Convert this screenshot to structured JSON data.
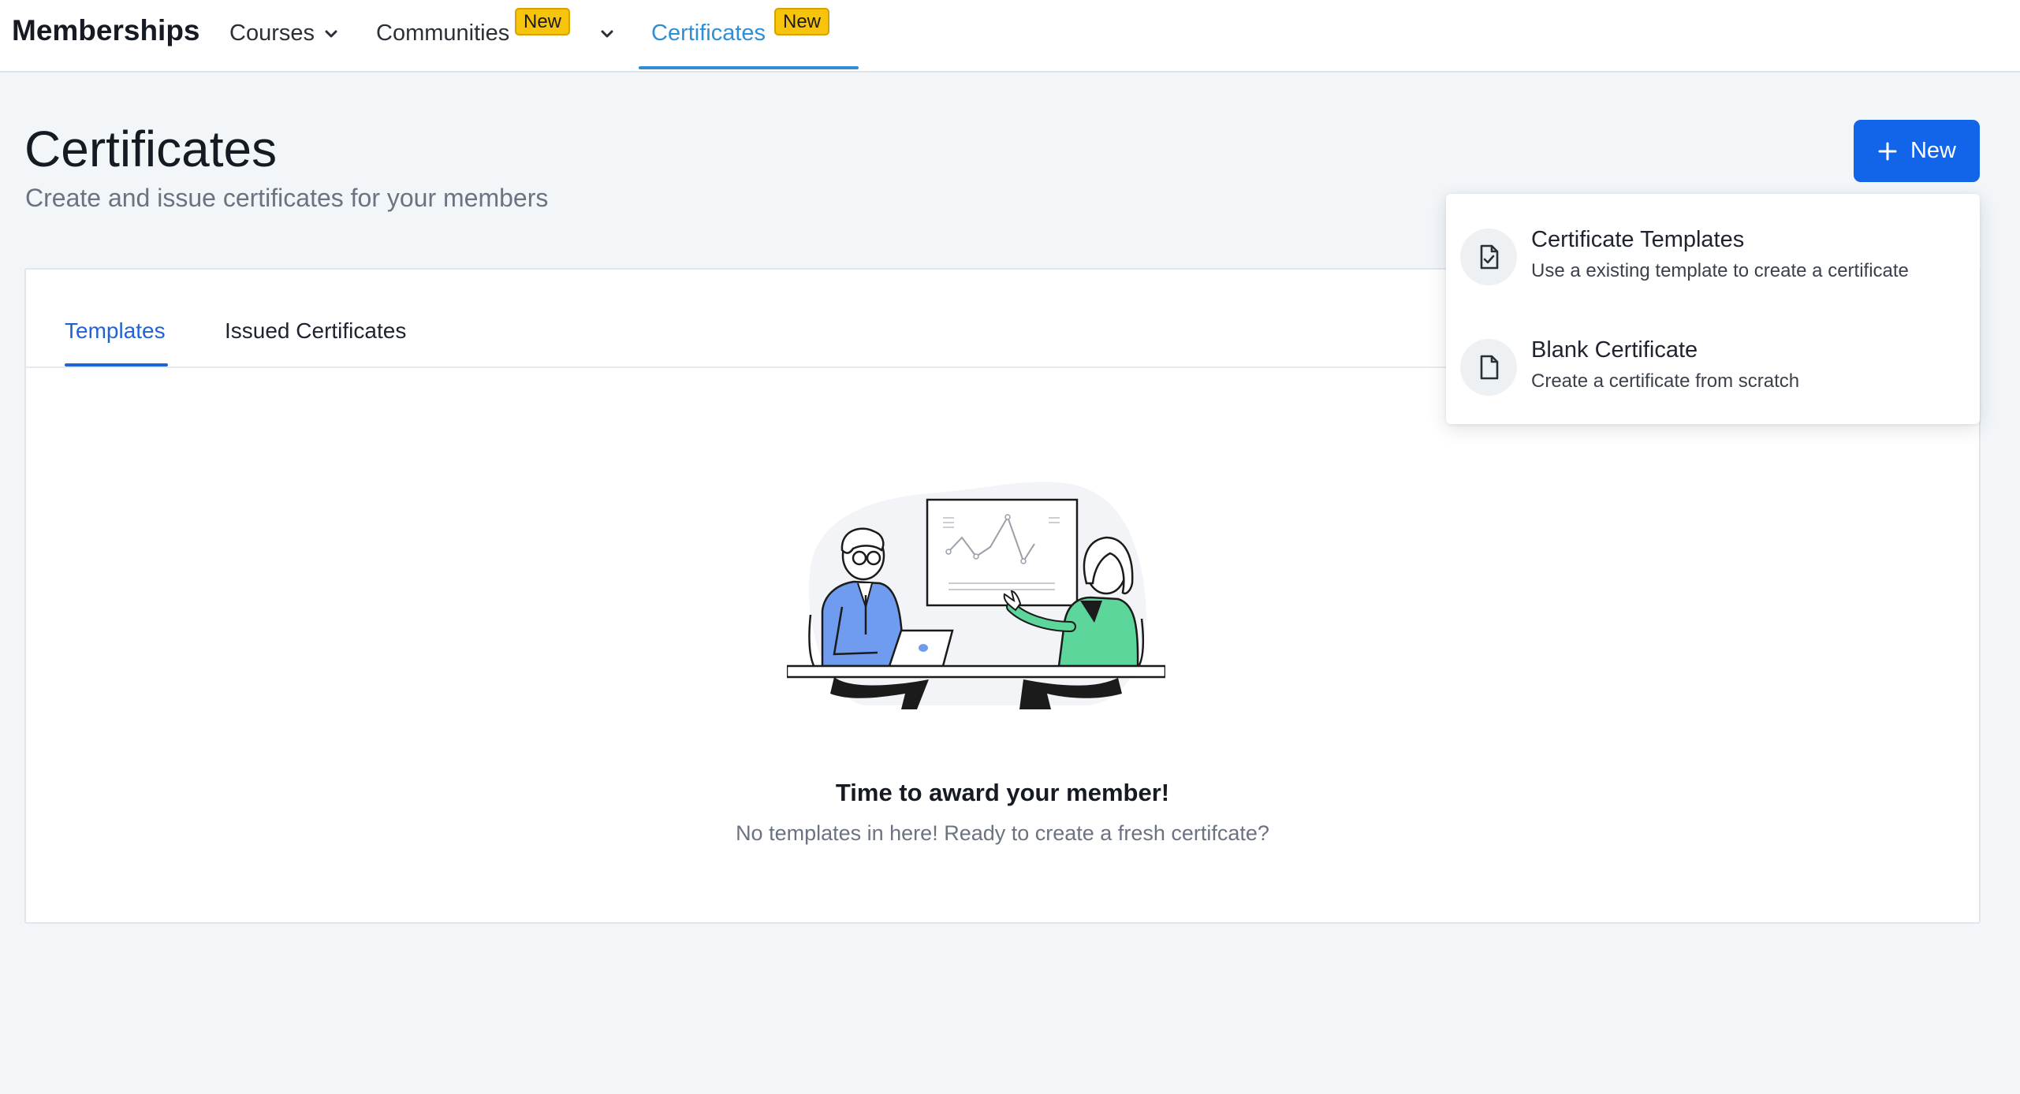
{
  "nav": {
    "brand": "Memberships",
    "items": [
      {
        "label": "Courses"
      },
      {
        "label": "Communities",
        "badge": "New"
      },
      {
        "label": "Certificates",
        "badge": "New"
      }
    ]
  },
  "header": {
    "title": "Certificates",
    "subtitle": "Create and issue certificates for your members",
    "new_button": "New"
  },
  "dropdown": {
    "items": [
      {
        "title": "Certificate Templates",
        "description": "Use a existing template to create a certificate",
        "icon": "file-check-icon"
      },
      {
        "title": "Blank Certificate",
        "description": "Create a certificate from scratch",
        "icon": "file-icon"
      }
    ]
  },
  "tabs": [
    {
      "label": "Templates"
    },
    {
      "label": "Issued Certificates"
    }
  ],
  "empty_state": {
    "title": "Time to award your member!",
    "subtitle": "No templates in here! Ready to create a fresh certifcate?"
  },
  "colors": {
    "primary": "#1265e8",
    "active_nav": "#2f8fd6",
    "badge": "#f7c30b",
    "background": "#f2f6f9"
  }
}
